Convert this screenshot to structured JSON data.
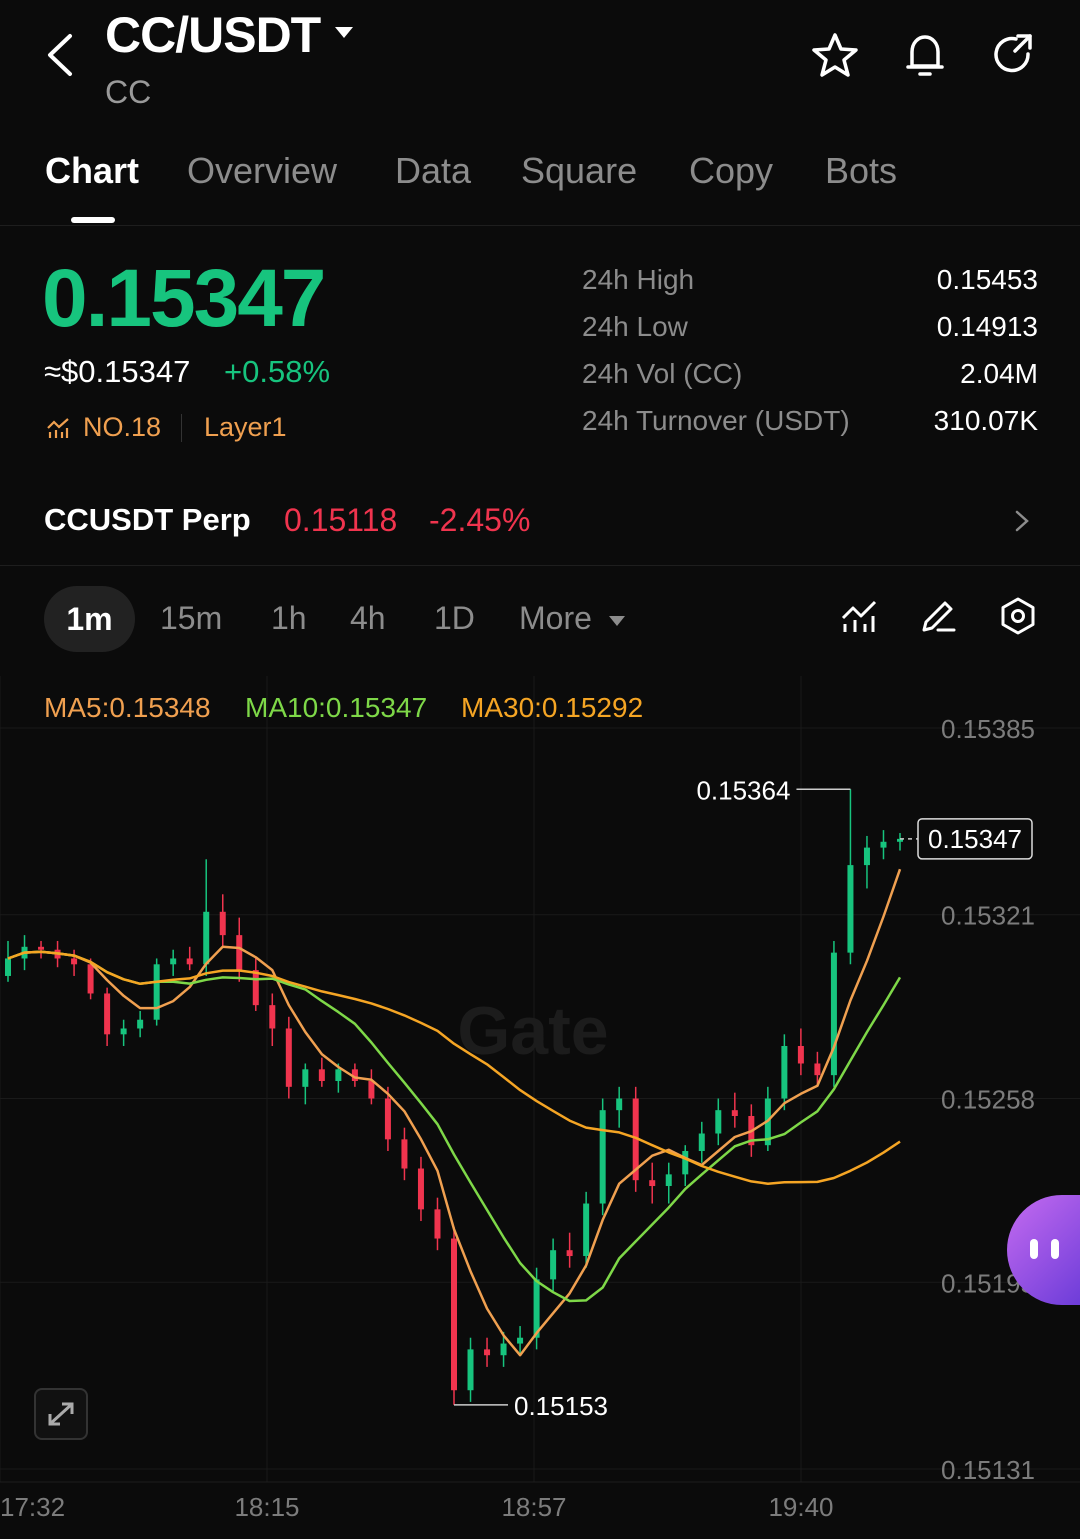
{
  "header": {
    "pair": "CC/USDT",
    "base": "CC",
    "icons": [
      "back-icon",
      "star-icon",
      "bell-icon",
      "refresh-icon"
    ]
  },
  "tabs": [
    {
      "label": "Chart",
      "active": true
    },
    {
      "label": "Overview"
    },
    {
      "label": "Data"
    },
    {
      "label": "Square"
    },
    {
      "label": "Copy"
    },
    {
      "label": "Bots"
    }
  ],
  "ticker": {
    "price": "0.15347",
    "fiat": "≈$0.15347",
    "change": "+0.58%",
    "rank": "NO.18",
    "category": "Layer1"
  },
  "stats": [
    {
      "label": "24h  High",
      "value": "0.15453"
    },
    {
      "label": "24h  Low",
      "value": "0.14913"
    },
    {
      "label": "24h  Vol (CC)",
      "value": "2.04M"
    },
    {
      "label": "24h  Turnover (USDT)",
      "value": "310.07K"
    }
  ],
  "perp": {
    "name": "CCUSDT Perp",
    "price": "0.15118",
    "change": "-2.45%"
  },
  "intervals": [
    {
      "label": "1m",
      "active": true
    },
    {
      "label": "15m"
    },
    {
      "label": "1h"
    },
    {
      "label": "4h"
    },
    {
      "label": "1D"
    },
    {
      "label": "More"
    }
  ],
  "colors": {
    "up": "#17c47e",
    "down": "#f0344e",
    "ma5": "#f0a050",
    "ma10": "#7ed848",
    "ma30": "#f5a524"
  },
  "chart_data": {
    "type": "candlestick",
    "ma": [
      {
        "label": "MA5:0.15348"
      },
      {
        "label": "MA10:0.15347"
      },
      {
        "label": "MA30:0.15292"
      }
    ],
    "y_ticks": [
      "0.15385",
      "0.15321",
      "0.15258",
      "0.15195",
      "0.15131"
    ],
    "x_ticks": [
      "17:32",
      "18:15",
      "18:57",
      "19:40"
    ],
    "ylim": [
      0.15131,
      0.15385
    ],
    "high_label": "0.15364",
    "low_label": "0.15153",
    "last_price": "0.15347",
    "watermark": "Gate",
    "candles": [
      [
        0.153,
        0.15312,
        0.15298,
        0.15306
      ],
      [
        0.15306,
        0.15314,
        0.15302,
        0.1531
      ],
      [
        0.1531,
        0.15312,
        0.15306,
        0.15309
      ],
      [
        0.15309,
        0.15312,
        0.15303,
        0.15306
      ],
      [
        0.15306,
        0.15309,
        0.153,
        0.15304
      ],
      [
        0.15304,
        0.15306,
        0.15292,
        0.15294
      ],
      [
        0.15294,
        0.15296,
        0.15276,
        0.1528
      ],
      [
        0.1528,
        0.15285,
        0.15276,
        0.15282
      ],
      [
        0.15282,
        0.15288,
        0.15279,
        0.15285
      ],
      [
        0.15285,
        0.15306,
        0.15283,
        0.15304
      ],
      [
        0.15304,
        0.15309,
        0.153,
        0.15306
      ],
      [
        0.15306,
        0.1531,
        0.15302,
        0.15304
      ],
      [
        0.15304,
        0.1534,
        0.153,
        0.15322
      ],
      [
        0.15322,
        0.15328,
        0.1531,
        0.15314
      ],
      [
        0.15314,
        0.1532,
        0.15298,
        0.15302
      ],
      [
        0.15302,
        0.15306,
        0.15288,
        0.1529
      ],
      [
        0.1529,
        0.15294,
        0.15276,
        0.15282
      ],
      [
        0.15282,
        0.15286,
        0.15258,
        0.15262
      ],
      [
        0.15262,
        0.1527,
        0.15256,
        0.15268
      ],
      [
        0.15268,
        0.15272,
        0.15262,
        0.15264
      ],
      [
        0.15264,
        0.1527,
        0.1526,
        0.15268
      ],
      [
        0.15268,
        0.1527,
        0.15262,
        0.15264
      ],
      [
        0.15264,
        0.15268,
        0.15256,
        0.15258
      ],
      [
        0.15258,
        0.15262,
        0.1524,
        0.15244
      ],
      [
        0.15244,
        0.15248,
        0.1523,
        0.15234
      ],
      [
        0.15234,
        0.15238,
        0.15216,
        0.1522
      ],
      [
        0.1522,
        0.15224,
        0.15206,
        0.1521
      ],
      [
        0.1521,
        0.15214,
        0.15153,
        0.15158
      ],
      [
        0.15158,
        0.15176,
        0.15154,
        0.15172
      ],
      [
        0.15172,
        0.15176,
        0.15166,
        0.1517
      ],
      [
        0.1517,
        0.15178,
        0.15166,
        0.15174
      ],
      [
        0.15174,
        0.1518,
        0.1517,
        0.15176
      ],
      [
        0.15176,
        0.152,
        0.15172,
        0.15196
      ],
      [
        0.15196,
        0.1521,
        0.15192,
        0.15206
      ],
      [
        0.15206,
        0.15212,
        0.152,
        0.15204
      ],
      [
        0.15204,
        0.15226,
        0.152,
        0.15222
      ],
      [
        0.15222,
        0.15258,
        0.15218,
        0.15254
      ],
      [
        0.15254,
        0.15262,
        0.15248,
        0.15258
      ],
      [
        0.15258,
        0.15262,
        0.15226,
        0.1523
      ],
      [
        0.1523,
        0.15236,
        0.15222,
        0.15228
      ],
      [
        0.15228,
        0.15236,
        0.15222,
        0.15232
      ],
      [
        0.15232,
        0.15242,
        0.15228,
        0.1524
      ],
      [
        0.1524,
        0.1525,
        0.15236,
        0.15246
      ],
      [
        0.15246,
        0.15258,
        0.15242,
        0.15254
      ],
      [
        0.15254,
        0.1526,
        0.15248,
        0.15252
      ],
      [
        0.15252,
        0.15256,
        0.15238,
        0.15242
      ],
      [
        0.15242,
        0.15262,
        0.1524,
        0.15258
      ],
      [
        0.15258,
        0.1528,
        0.15254,
        0.15276
      ],
      [
        0.15276,
        0.15282,
        0.15266,
        0.1527
      ],
      [
        0.1527,
        0.15274,
        0.15262,
        0.15266
      ],
      [
        0.15266,
        0.15312,
        0.15262,
        0.15308
      ],
      [
        0.15308,
        0.15364,
        0.15304,
        0.15338
      ],
      [
        0.15338,
        0.15348,
        0.1533,
        0.15344
      ],
      [
        0.15344,
        0.1535,
        0.1534,
        0.15346
      ],
      [
        0.15346,
        0.15349,
        0.15343,
        0.15347
      ]
    ]
  }
}
